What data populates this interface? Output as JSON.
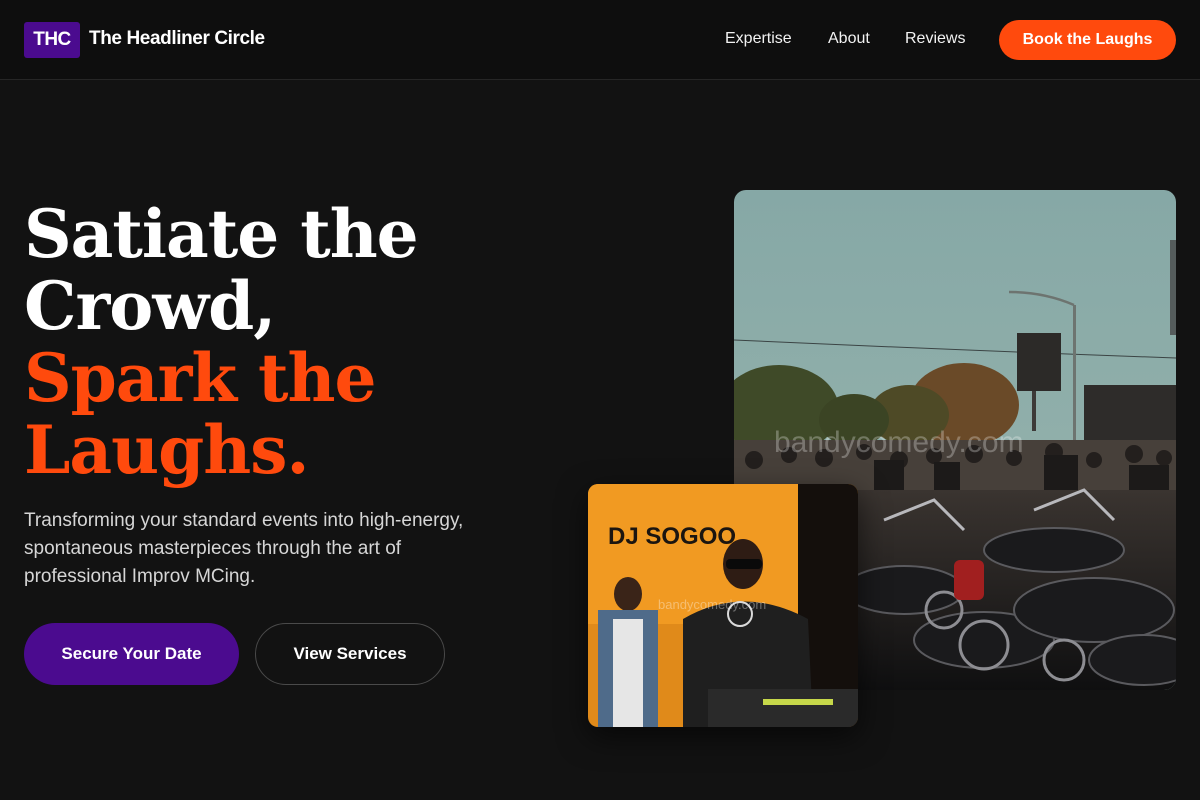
{
  "header": {
    "logo_text": "THC",
    "brand_name": "The Headliner Circle",
    "nav": [
      "Expertise",
      "About",
      "Reviews"
    ],
    "cta_label": "Book the Laughs"
  },
  "hero": {
    "headline_lines": [
      "Satiate the",
      "Crowd,",
      "Spark the",
      "Laughs."
    ],
    "subtext": "Transforming your standard events into high-energy, spontaneous masterpieces through the art of professional Improv MCing.",
    "primary_button": "Secure Your Date",
    "secondary_button": "View Services"
  },
  "images": {
    "large_watermark": "bandycomedy.com",
    "small_banner_text": "DJ SOGOO",
    "small_watermark": "bandycomedy.com"
  },
  "colors": {
    "background": "#121212",
    "accent_orange": "#ff4a0d",
    "brand_purple": "#4b0b8f"
  }
}
